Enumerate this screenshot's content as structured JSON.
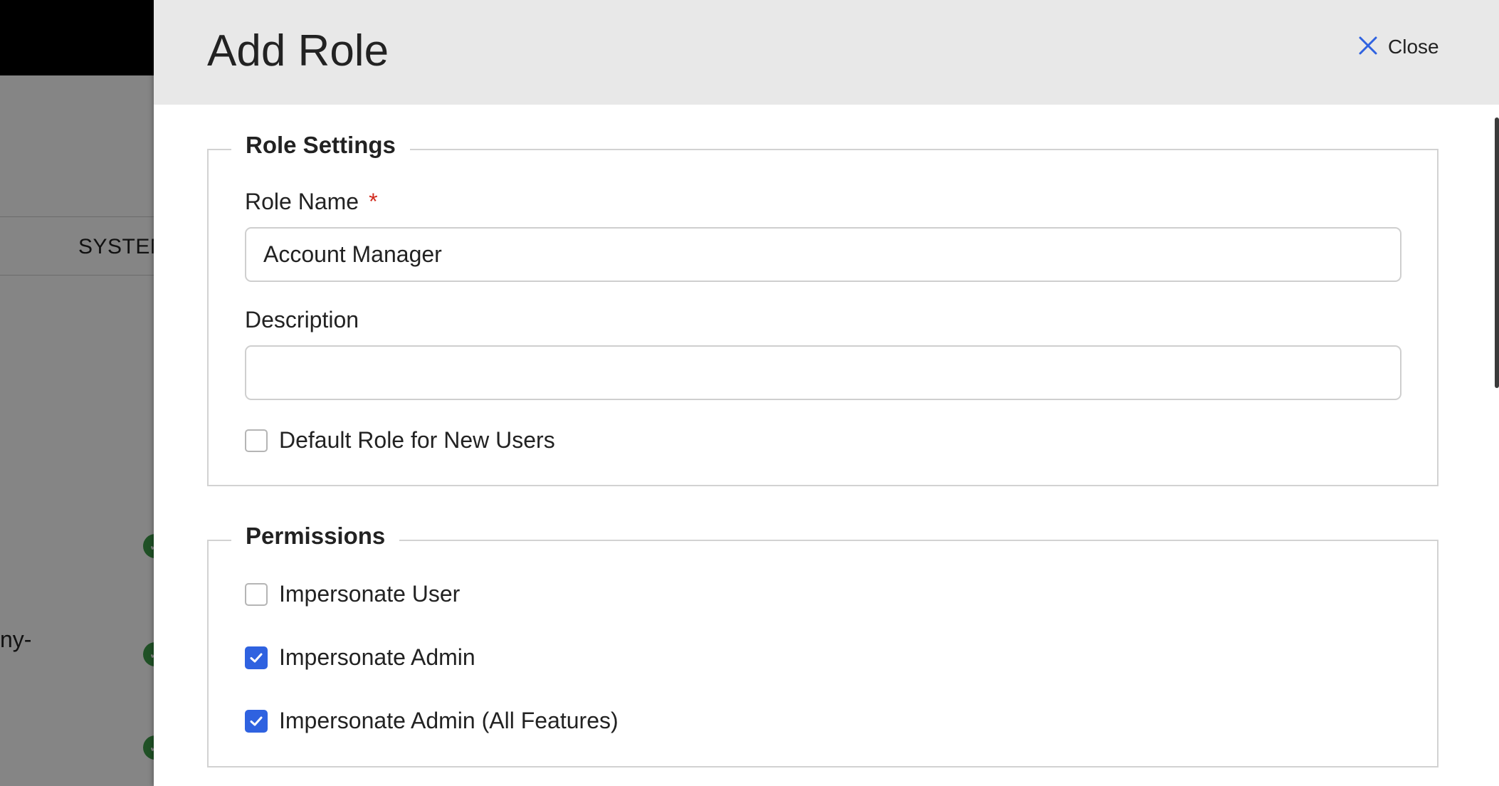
{
  "background": {
    "tab_label": "SYSTEM",
    "text_fragment": "ny-"
  },
  "panel": {
    "title": "Add Role",
    "close_label": "Close"
  },
  "role_settings": {
    "legend": "Role Settings",
    "role_name": {
      "label": "Role Name",
      "required_marker": "*",
      "value": "Account Manager"
    },
    "description": {
      "label": "Description",
      "value": ""
    },
    "default_role": {
      "label": "Default Role for New Users",
      "checked": false
    }
  },
  "permissions": {
    "legend": "Permissions",
    "items": [
      {
        "label": "Impersonate User",
        "checked": false
      },
      {
        "label": "Impersonate Admin",
        "checked": true
      },
      {
        "label": "Impersonate Admin (All Features)",
        "checked": true
      }
    ]
  },
  "colors": {
    "accent": "#2f62e0",
    "required": "#d12a1e",
    "header_bg": "#e8e8e8",
    "status_green": "#3e9b4a"
  }
}
